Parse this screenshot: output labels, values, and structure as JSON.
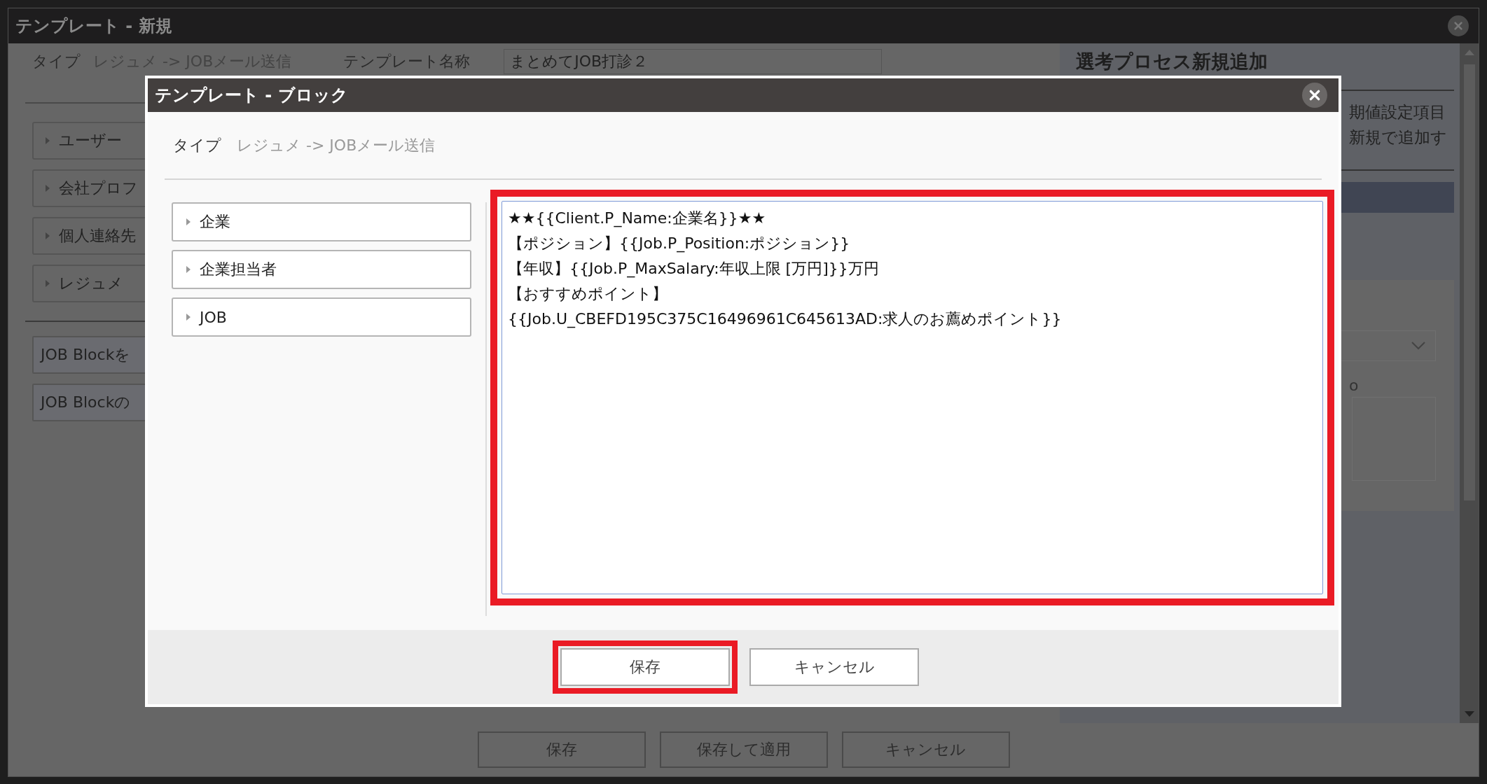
{
  "back_window": {
    "title": "テンプレート - 新規",
    "type_label": "タイプ",
    "type_value": "レジュメ -> JOBメール送信",
    "name_label": "テンプレート名称",
    "name_value": "まとめてJOB打診２",
    "sidebar_items": [
      {
        "label": "ユーザー",
        "expanded": false
      },
      {
        "label": "会社プロフ",
        "expanded": false
      },
      {
        "label": "個人連絡先",
        "expanded": false
      },
      {
        "label": "レジュメ",
        "expanded": false
      }
    ],
    "block_buttons": [
      "JOB Blockを",
      "JOB Blockの"
    ],
    "right_panel": {
      "title": "選考プロセス新規追加",
      "text_lines": [
        "期値設定項目",
        "新規で追加す"
      ],
      "field_label": "o"
    },
    "buttons": [
      "保存",
      "保存して適用",
      "キャンセル"
    ]
  },
  "modal": {
    "title": "テンプレート - ブロック",
    "type_label": "タイプ",
    "type_value": "レジュメ -> JOBメール送信",
    "categories": [
      {
        "label": "企業",
        "expanded": false
      },
      {
        "label": "企業担当者",
        "expanded": false
      },
      {
        "label": "JOB",
        "expanded": false
      }
    ],
    "editor_highlighted": true,
    "body_lines": [
      "★★{{Client.P_Name:企業名}}★★",
      "【ポジション】{{Job.P_Position:ポジション}}",
      "【年収】{{Job.P_MaxSalary:年収上限 [万円]}}万円",
      "【おすすめポイント】",
      "{{Job.U_CBEFD195C375C16496961C645613AD:求人のお薦めポイント}}"
    ],
    "buttons": [
      {
        "label": "保存",
        "highlighted": true
      },
      {
        "label": "キャンセル",
        "highlighted": false
      }
    ]
  }
}
